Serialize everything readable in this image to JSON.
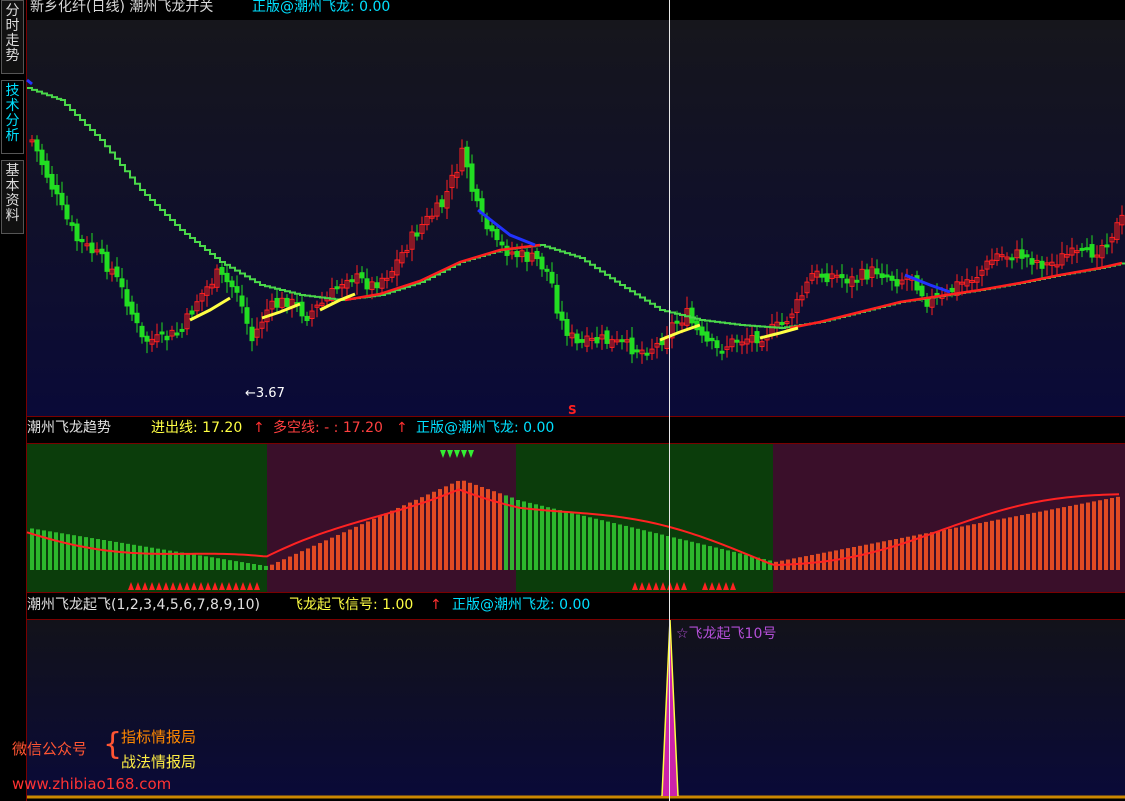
{
  "sidebar": {
    "tabs": [
      {
        "label": "分时走势",
        "active": false
      },
      {
        "label": "技术分析",
        "active": true
      },
      {
        "label": "基本资料",
        "active": false
      }
    ]
  },
  "panel1": {
    "title": "新乡化纤(日线) 潮州飞龙开关",
    "info": "正版@潮州飞龙: 0.00",
    "low_label": "←3.67",
    "marker": "S"
  },
  "panel2": {
    "title": "潮州飞龙趋势",
    "line1_label": "进出线: 17.20",
    "line2_label": "多空线: - : 17.20",
    "info": "正版@潮州飞龙: 0.00",
    "arrow": "↑"
  },
  "panel3": {
    "title": "潮州飞龙起飞(1,2,3,4,5,6,7,8,9,10)",
    "signal_label": "飞龙起飞信号: 1.00",
    "info": "正版@潮州飞龙: 0.00",
    "annotation": "☆飞龙起飞10号",
    "arrow": "↑"
  },
  "watermark": {
    "left_label": "微信公众号",
    "brace": "{",
    "item1": "指标情报局",
    "item2": "战法情报局",
    "url": "www.zhibiao168.com"
  },
  "colors": {
    "bg_top": "#0a0a1e",
    "bull": "#ff2020",
    "bear": "#22dd22",
    "trend_blue": "#2233ff",
    "yellow": "#ffff44",
    "cyan": "#00e0ff",
    "green_zone": "#0b3d0b",
    "purple_zone": "#3a0f2a",
    "spike": "#cc22aa"
  }
}
